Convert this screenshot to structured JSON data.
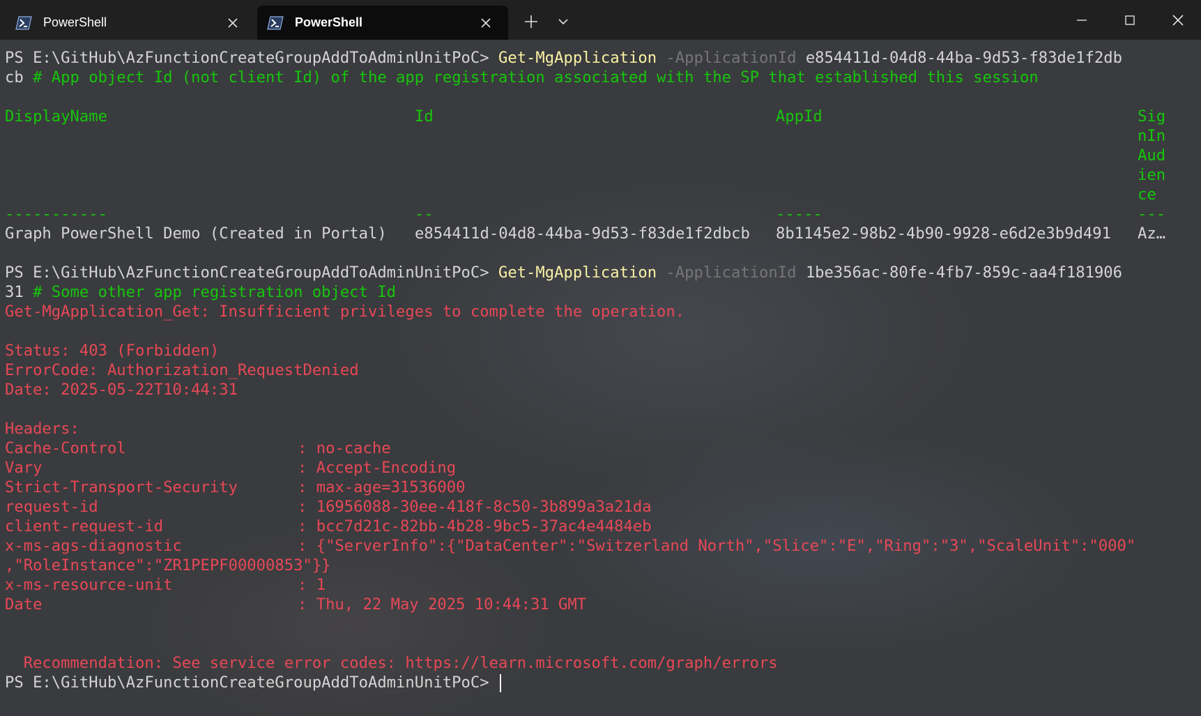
{
  "tabs": [
    {
      "label": "PowerShell",
      "active": false,
      "icon": "powershell-icon"
    },
    {
      "label": "PowerShell",
      "active": true,
      "icon": "powershell-icon"
    }
  ],
  "window_controls": {
    "new_tab": "+",
    "dropdown": "⌄",
    "minimize": "–",
    "maximize": "□",
    "close": "✕"
  },
  "colors": {
    "background": "#3a3b3e",
    "prompt": "#d4d4d4",
    "command": "#f9f1a5",
    "comment": "#16c60c",
    "parameter": "#767676",
    "error": "#e74856",
    "table_header": "#16c60c"
  },
  "terminal": {
    "prompt": "PS E:\\GitHub\\AzFunctionCreateGroupAddToAdminUnitPoC> ",
    "cmd1": {
      "command": "Get-MgApplication",
      "param": "-ApplicationId",
      "value_line1": "e854411d-04d8-44ba-9d53-f83de1f2db",
      "value_line2": "cb",
      "comment": "# App object Id (not client Id) of the app registration associated with the SP that established this session"
    },
    "table": {
      "headers": [
        "DisplayName",
        "Id",
        "AppId",
        "Sig"
      ],
      "header_wrap": [
        "nIn",
        "Aud",
        "ien",
        "ce"
      ],
      "underlines": [
        "-----------",
        "--",
        "-----",
        "---"
      ],
      "row": [
        "Graph PowerShell Demo (Created in Portal)",
        "e854411d-04d8-44ba-9d53-f83de1f2dbcb",
        "8b1145e2-98b2-4b90-9928-e6d2e3b9d491",
        "Az…"
      ]
    },
    "cmd2": {
      "command": "Get-MgApplication",
      "param": "-ApplicationId",
      "value_line1": "1be356ac-80fe-4fb7-859c-aa4f181906",
      "value_line2": "31",
      "comment": "# Some other app registration object Id"
    },
    "error": {
      "message": "Get-MgApplication_Get: Insufficient privileges to complete the operation.",
      "status": "Status: 403 (Forbidden)",
      "error_code": "ErrorCode: Authorization_RequestDenied",
      "date": "Date: 2025-05-22T10:44:31",
      "headers_title": "Headers:",
      "headers": [
        {
          "key": "Cache-Control",
          "value": "no-cache"
        },
        {
          "key": "Vary",
          "value": "Accept-Encoding"
        },
        {
          "key": "Strict-Transport-Security",
          "value": "max-age=31536000"
        },
        {
          "key": "request-id",
          "value": "16956088-30ee-418f-8c50-3b899a3a21da"
        },
        {
          "key": "client-request-id",
          "value": "bcc7d21c-82bb-4b28-9bc5-37ac4e4484eb"
        },
        {
          "key": "x-ms-ags-diagnostic",
          "value": "{\"ServerInfo\":{\"DataCenter\":\"Switzerland North\",\"Slice\":\"E\",\"Ring\":\"3\",\"ScaleUnit\":\"000\""
        },
        {
          "key": "",
          "value": ",\"RoleInstance\":\"ZR1PEPF00000853\"}}"
        },
        {
          "key": "x-ms-resource-unit",
          "value": "1"
        },
        {
          "key": "Date",
          "value": "Thu, 22 May 2025 10:44:31 GMT"
        }
      ],
      "header_separator": ": ",
      "recommendation": "  Recommendation: See service error codes: https://learn.microsoft.com/graph/errors"
    }
  }
}
